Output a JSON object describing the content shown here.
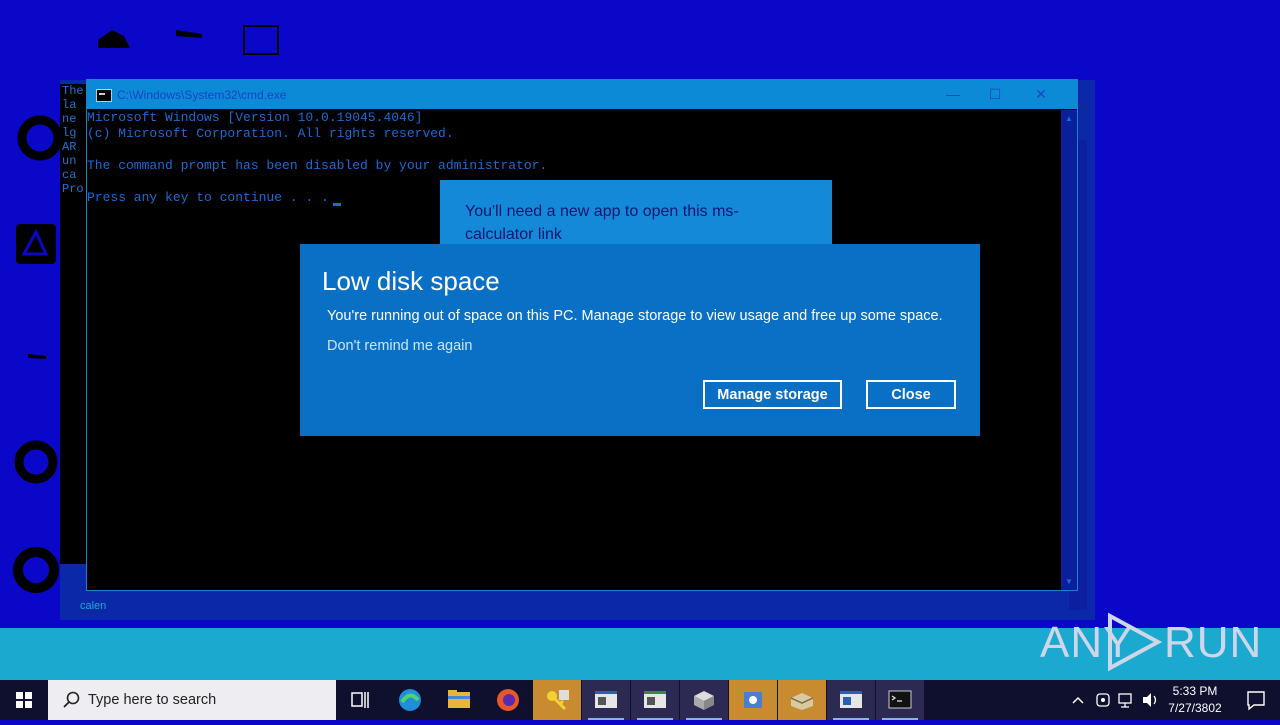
{
  "colors": {
    "desktop": "#0a07c8",
    "dialog_bg": "#0a70c6",
    "cmd_text": "#1a6ad8",
    "taskbar": "#0f0f2e"
  },
  "background_window": {
    "left_strip_lines": [
      "The",
      "la",
      "",
      "ne",
      "lg",
      "",
      "AR",
      "un",
      "",
      "ca",
      "Pro"
    ],
    "calendar_label": "calen"
  },
  "cmd": {
    "title": "C:\\Windows\\System32\\cmd.exe",
    "lines": [
      "Microsoft Windows [Version 10.0.19045.4046]",
      "(c) Microsoft Corporation. All rights reserved.",
      "The command prompt has been disabled by your administrator.",
      "Press any key to continue . . ."
    ]
  },
  "app_notice": {
    "message": "You'll need a new app to open this ms-calculator link"
  },
  "dialog": {
    "title": "Low disk space",
    "body": "You're running out of space on this PC. Manage storage to view usage and free up some space.",
    "remind_link": "Don't remind me again",
    "manage_button": "Manage storage",
    "close_button": "Close"
  },
  "watermark": {
    "left": "ANY",
    "right": "RUN"
  },
  "taskbar": {
    "search_placeholder": "Type here to search",
    "apps": [
      {
        "name": "task-view-icon"
      },
      {
        "name": "edge-icon"
      },
      {
        "name": "file-explorer-icon"
      },
      {
        "name": "firefox-icon"
      },
      {
        "name": "key-app-icon"
      },
      {
        "name": "window-app-icon"
      },
      {
        "name": "window-app-icon"
      },
      {
        "name": "package-icon"
      },
      {
        "name": "installer-icon"
      },
      {
        "name": "box-icon"
      },
      {
        "name": "window-app-icon"
      },
      {
        "name": "cmd-icon"
      }
    ],
    "clock_time": "5:33 PM",
    "clock_date": "7/27/3802"
  }
}
